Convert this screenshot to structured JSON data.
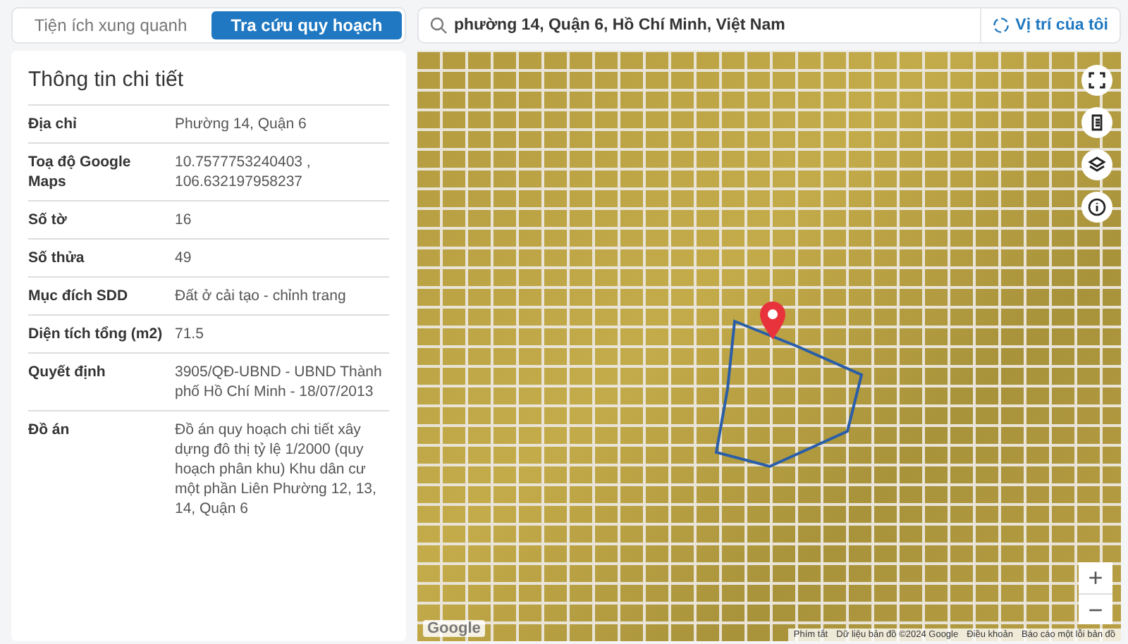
{
  "tabs": [
    {
      "label": "Tiện ích xung quanh",
      "selected": false
    },
    {
      "label": "Tra cứu quy hoạch",
      "selected": true
    }
  ],
  "search": {
    "value": "phường 14, Quận 6, Hồ Chí Minh, Việt Nam"
  },
  "location_button": {
    "label": "Vị trí của tôi"
  },
  "details": {
    "title": "Thông tin chi tiết",
    "rows": [
      {
        "label": "Địa chỉ",
        "value": "Phường 14, Quận 6"
      },
      {
        "label": "Toạ độ Google Maps",
        "value": "10.7577753240403 , 106.632197958237"
      },
      {
        "label": "Số tờ",
        "value": "16"
      },
      {
        "label": "Số thửa",
        "value": "49"
      },
      {
        "label": "Mục đích SDD",
        "value": "Đất ở cải tạo - chỉnh trang"
      },
      {
        "label": "Diện tích tổng (m2)",
        "value": "71.5"
      },
      {
        "label": "Quyết định",
        "value": "3905/QĐ-UBND - UBND Thành phố Hồ Chí Minh - 18/07/2013"
      },
      {
        "label": "Đồ án",
        "value": "Đồ án quy hoạch chi tiết xây dựng đô thị tỷ lệ 1/2000 (quy hoạch phân khu) Khu dân cư một phần Liên Phường 12, 13, 14, Quận 6"
      }
    ]
  },
  "map": {
    "zoom_in": "+",
    "zoom_out": "−",
    "logo": "Google",
    "attribution": [
      "Phím tắt",
      "Dữ liệu bản đồ ©2024 Google",
      "Điều khoản",
      "Báo cáo một lỗi bản đồ"
    ]
  }
}
